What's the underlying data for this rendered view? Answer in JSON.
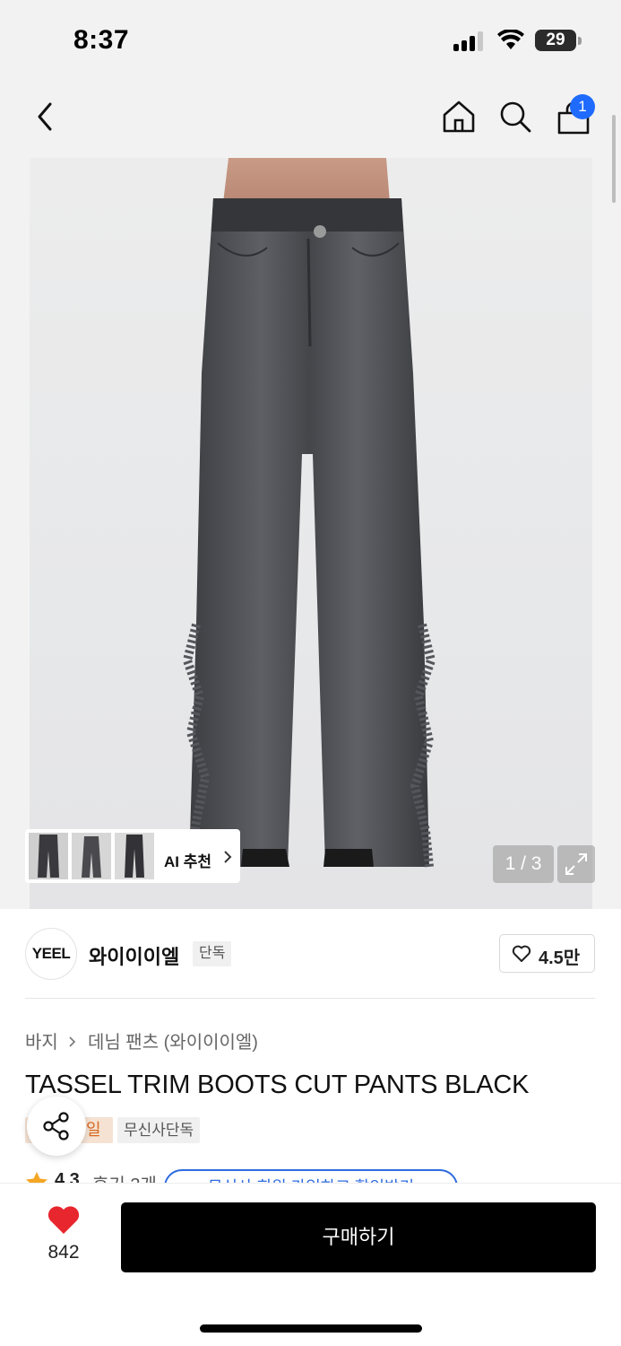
{
  "status_bar": {
    "time": "8:37",
    "battery": "29"
  },
  "nav": {
    "cart_count": "1"
  },
  "gallery": {
    "ai_label": "AI 추천",
    "counter": "1 / 3",
    "thumbnails": [
      "thumb-1",
      "thumb-2",
      "thumb-3"
    ]
  },
  "brand": {
    "logo_text": "YEEL",
    "name": "와이이이엘",
    "tag": "단독",
    "likes": "4.5만"
  },
  "breadcrumb": {
    "items": [
      "바지",
      "데님 팬츠 (와이이이엘)"
    ]
  },
  "product": {
    "title": "TASSEL TRIM BOOTS CUT PANTS BLACK",
    "tag_orange": "일",
    "tag_gray": "무신사단독",
    "rating": "4.3",
    "reviews": "후기 3개",
    "coupon": "무신사 회원 가입하고 할인받기"
  },
  "bottom": {
    "wish_count": "842",
    "buy_label": "구매하기"
  },
  "colors": {
    "accent_blue": "#1f6bff",
    "heart_red": "#e8262d",
    "buy_black": "#000000"
  }
}
